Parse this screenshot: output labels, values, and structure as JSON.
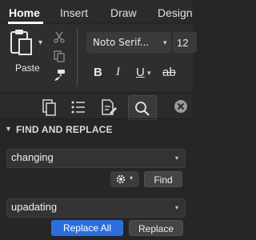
{
  "ribbon_tabs": [
    "Home",
    "Insert",
    "Draw",
    "Design"
  ],
  "ribbon": {
    "paste_label": "Paste",
    "font_name": "Noto Serif...",
    "font_size": "12",
    "format_buttons": [
      "B",
      "I",
      "U",
      "ab"
    ]
  },
  "sidebar_tabs": [
    "pages-icon",
    "list-icon",
    "edit-icon",
    "search-icon",
    "close-icon"
  ],
  "find_replace": {
    "title": "FIND AND REPLACE",
    "find_value": "changing",
    "find_button": "Find",
    "replace_value": "upadating",
    "replace_all_button": "Replace All",
    "replace_button": "Replace"
  },
  "colors": {
    "background": "#262626",
    "accent": "#2d6ede"
  }
}
